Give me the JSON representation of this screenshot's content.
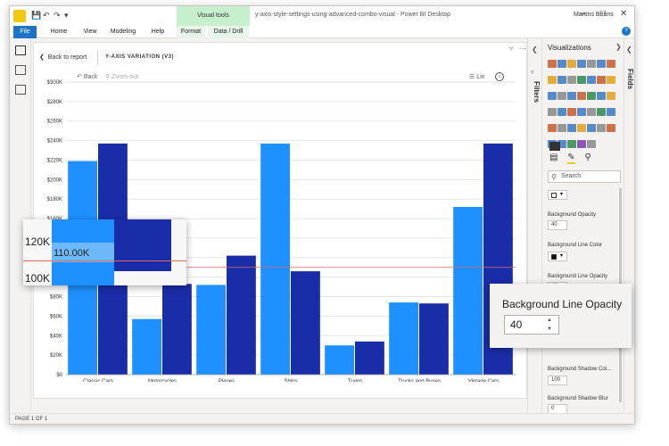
{
  "titlebar": {
    "window_title": "y-axis-style-settings-using-advanced-combo-visual - Power BI Desktop",
    "user": "Martins Berins",
    "context_tab": "Visual tools"
  },
  "ribbon": {
    "tabs": [
      "File",
      "Home",
      "View",
      "Modeling",
      "Help",
      "Format",
      "Data / Drill"
    ]
  },
  "visual": {
    "back_to_report": "Back to report",
    "title": "Y-AXIS VARIATION (V3)",
    "back": "Back",
    "zoom_out": "Zoom-out",
    "lin": "Lin"
  },
  "panes": {
    "filters": "Filters",
    "visualizations": "Visualizations",
    "fields": "Fields",
    "search_placeholder": "Search"
  },
  "format_props": {
    "background_opacity_label": "Background Opacity",
    "background_opacity_value": "40",
    "background_line_color_label": "Background Line Color",
    "background_line_opacity_label": "Background Line Opacity",
    "background_line_opacity_value": "40",
    "background_shadow_color_label": "Background Shadow Col...",
    "background_shadow_color_value": "100",
    "background_shadow_blur_label": "Background Shadow Blur",
    "background_shadow_blur_value": "0"
  },
  "status": {
    "page": "PAGE 1 OF 1"
  },
  "zoom_callout_left": {
    "tick_top": "120K",
    "tick_bottom": "100K",
    "value_label": "110.00K"
  },
  "zoom_callout_right": {
    "label": "Background Line Opacity",
    "value": "40"
  },
  "colors": {
    "series_light": "#1e90ff",
    "series_dark": "#1a2da8",
    "reference_line": "#e06666",
    "accent": "#1b74c7"
  },
  "chart_data": {
    "type": "bar",
    "categories": [
      "Classic Cars",
      "Motorcycles",
      "Planes",
      "Ships",
      "Trains",
      "Trucks and Buses",
      "Vintage Cars"
    ],
    "series": [
      {
        "values": [
          219000,
          57000,
          92000,
          237000,
          30000,
          74000,
          172000
        ]
      },
      {
        "values": [
          237000,
          93000,
          122000,
          106000,
          34000,
          73000,
          237000
        ]
      }
    ],
    "yticks": [
      "$0",
      "$20K",
      "$40K",
      "$60K",
      "$80K",
      "$100K",
      "$120K",
      "$140K",
      "$160K",
      "$180K",
      "$200K",
      "$220K",
      "$240K",
      "$260K",
      "$280K",
      "$300K"
    ],
    "ylim": [
      0,
      300000
    ],
    "reference_line": 110000,
    "grid": true
  }
}
